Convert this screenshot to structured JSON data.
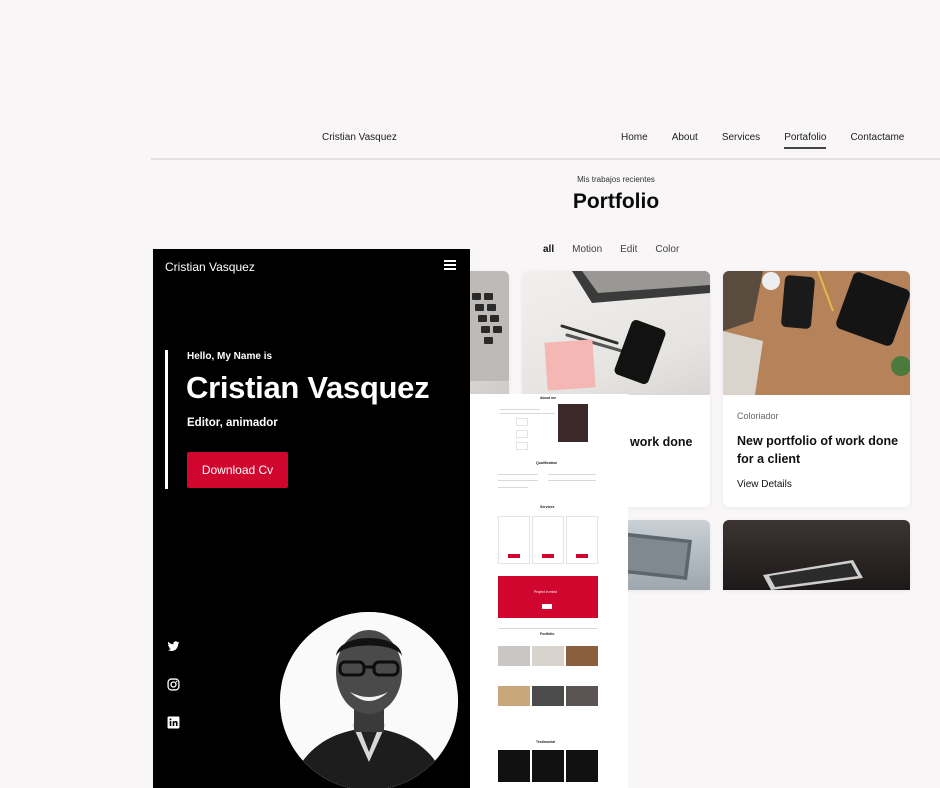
{
  "site": {
    "brand": "Cristian Vasquez",
    "menu": [
      "Home",
      "About",
      "Services",
      "Portafolio",
      "Contactame"
    ],
    "active_menu": "Portafolio"
  },
  "portfolio": {
    "subtitle": "Mis trabajos recientes",
    "title": "Portfolio",
    "filters": [
      "all",
      "Motion",
      "Edit",
      "Color"
    ],
    "active_filter": "all",
    "cards": [
      {
        "category": "",
        "title": "work done",
        "details": ""
      },
      {
        "category": "",
        "title": "work done",
        "details": ""
      },
      {
        "category": "Coloriador",
        "title": "New portfolio of work done for a client",
        "details": "View Details"
      }
    ]
  },
  "mobile": {
    "brand": "Cristian Vasquez",
    "hello": "Hello, My Name is",
    "name": "Cristian Vasquez",
    "role": "Editor, animador",
    "cta": "Download Cv",
    "social_icons": [
      "twitter-icon",
      "instagram-icon",
      "linkedin-icon"
    ]
  },
  "thumbnail": {
    "about_title": "About me",
    "qualification_title": "Qualification",
    "services_title": "Services",
    "project_title": "Project in mind",
    "portfolio_title": "Portfolio",
    "testimonial_title": "Testimonial"
  },
  "colors": {
    "accent": "#d1062e",
    "page_bg": "#f8f6f7",
    "mobile_bg": "#000000"
  }
}
